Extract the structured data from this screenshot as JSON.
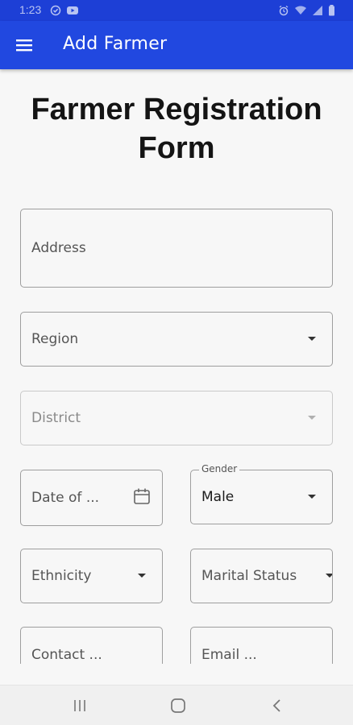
{
  "status_bar": {
    "time": "1:23",
    "left_icons": [
      "check-circle-icon",
      "youtube-icon"
    ],
    "right_icons": [
      "alarm-icon",
      "wifi-icon",
      "signal-icon",
      "battery-icon"
    ]
  },
  "app_bar": {
    "title": "Add Farmer",
    "menu_icon": "hamburger-menu-icon",
    "color": "#2148e0"
  },
  "form": {
    "title": "Farmer Registration Form",
    "fields": {
      "address": {
        "label": "Address"
      },
      "region": {
        "label": "Region"
      },
      "district": {
        "label": "District",
        "disabled": true
      },
      "dob": {
        "label": "Date of ...",
        "icon": "calendar-icon"
      },
      "gender": {
        "label": "Gender",
        "value": "Male"
      },
      "ethnicity": {
        "label": "Ethnicity"
      },
      "marital_status": {
        "label": "Marital Status"
      },
      "contact": {
        "label": "Contact ..."
      },
      "email": {
        "label": "Email ..."
      }
    }
  },
  "nav_bar": {
    "buttons": [
      "recent-apps-icon",
      "home-icon",
      "back-icon"
    ]
  }
}
